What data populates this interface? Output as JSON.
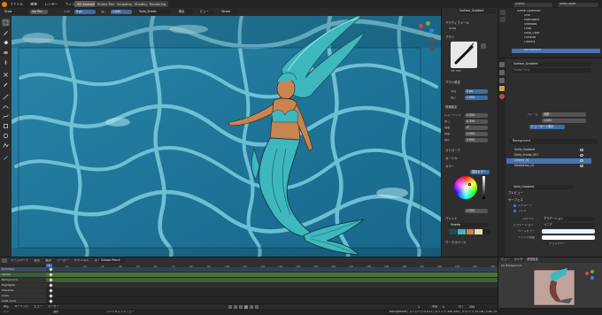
{
  "menu": {
    "items": [
      "ファイル",
      "編集",
      "レンダー",
      "ウィンドウ",
      "ヘルプ"
    ]
  },
  "workspace_tabs": [
    "2D Animation",
    "Stroke Paint",
    "Sculpting",
    "Shading",
    "Rendering"
  ],
  "header": {
    "mode": "Draw",
    "brush": "Ink Pen",
    "strength_label": "強さ",
    "strength_value": "1.000",
    "radius_value": "5 px",
    "material": "Solid_Stroke",
    "origin_label": "原点",
    "view_label": "ビュー",
    "scene": "Scene",
    "view_layer": "View Layer",
    "layer": "Background"
  },
  "viewport_overlay": {
    "object_label": "(1) Stroke",
    "toolbar_label": "Stroke"
  },
  "brush_panel": {
    "title": "ブラシ",
    "brush_name": "Ink Pen",
    "settings_header": "ブラシ設定",
    "radius_label": "半径",
    "radius_value": "5 px",
    "strength_label": "強さ",
    "strength_value": "1.000",
    "advanced_header": "詳細設定",
    "smooth_label": "スムージング",
    "smooth_value": "0.300",
    "thickness_label": "太さ",
    "thickness_value": "0.350",
    "angle_label": "角度",
    "angle_value": "0°",
    "factor_label": "係数",
    "factor_value": "0.500",
    "min_label": "最小",
    "min_value": "0.000",
    "stroke_header": "ストローク",
    "cursor_header": "カーソル",
    "color_header": "カラー",
    "mode_label": "頂点カラー",
    "fill_header": "ブレンド",
    "palette_header": "パレット",
    "palette_name": "Palette",
    "workspace_header": "ワークスペース",
    "hsv_value": "1.000",
    "tool_settings": "アクティブツール",
    "draw_label": "Draw"
  },
  "outliner": {
    "header": "Scene",
    "items": [
      "Scene Collection",
      "Grid",
      "Hightlights",
      "Shadows",
      "Lines",
      "Solid_Color",
      "Outlines",
      "Camera",
      "Background"
    ]
  },
  "properties": {
    "object_name": "Surface_Gradient",
    "mode_label": "Stroke Only",
    "texture_field": "Solid_Gradient",
    "frame_label": "フレーム",
    "frame_value": "自動",
    "blend_value": "1.000",
    "viewport_label": "ビューポート表示",
    "gp_layer": "Background",
    "layers": [
      "Solid_Gradient",
      "Solid_Stroke_001",
      "Lineart_01",
      "Headdress_01"
    ],
    "material_header": "Solid_Gradient",
    "preview_header": "プレビュー",
    "surface_header": "サーフェス",
    "stroke_label": "ストローク",
    "fill_label": "フィル",
    "style_label": "スタイル",
    "style_value": "グラデーション",
    "gradient_label": "グラデーション",
    "gradient_value": "リニア",
    "base_color_label": "ベースカラー",
    "mix_label": "ミックス係数",
    "texture_label": "テクスチャー"
  },
  "dopesheet": {
    "header_items": [
      "ドープシート",
      "表示",
      "選択",
      "マーカー",
      "チャンネル",
      "キー"
    ],
    "mode": "Grease Pencil",
    "tracks": [
      "Summary",
      "Stroke",
      "Background",
      "Highlights",
      "Shadows",
      "Lines",
      "Solid_Color"
    ],
    "frame_numbers": [
      "0",
      "10",
      "20",
      "30",
      "40",
      "50",
      "60",
      "70",
      "80",
      "90",
      "100",
      "110",
      "120",
      "130",
      "140",
      "150",
      "160",
      "170",
      "180",
      "190",
      "200",
      "210",
      "220",
      "230",
      "240",
      "250"
    ],
    "footer_items": [
      "再生",
      "キーイング",
      "ビュー",
      "マーカー"
    ],
    "start_label": "開始",
    "start_value": "1",
    "end_label": "終了",
    "end_value": "250",
    "current_frame": "1"
  },
  "camera_view": {
    "header_items": [
      "ビュー",
      "カメラ",
      "透視投影"
    ],
    "label": "(1) Background"
  },
  "status_bar": {
    "left": "パン",
    "left2": "選択",
    "middle": "コンテキストメニュー",
    "info": "Background | ストローク:4,912 | ポイント:189,458 | メモリ: 2.14 GB | 2.80.74"
  },
  "colors": {
    "accent": "#4772b3",
    "water_dark": "#1a6f93",
    "water_light": "#56b0cc",
    "mermaid_hair": "#3fb7bf",
    "mermaid_skin": "#c9844f"
  }
}
